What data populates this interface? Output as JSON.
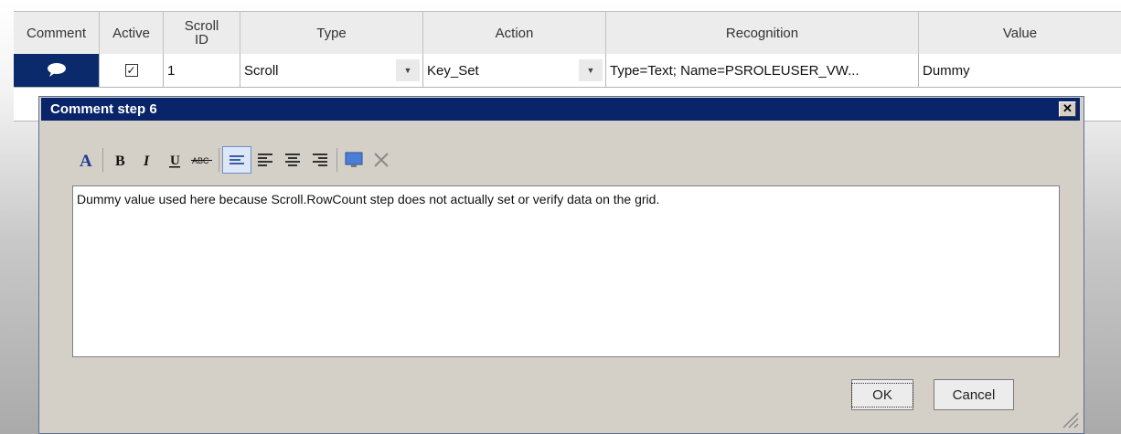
{
  "grid": {
    "columns": [
      "Comment",
      "Active",
      "Scroll ID",
      "Type",
      "Action",
      "Recognition",
      "Value"
    ],
    "row": {
      "active_mark": "✓",
      "scroll_id": "1",
      "type": "Scroll",
      "action": "Key_Set",
      "recognition": "Type=Text; Name=PSROLEUSER_VW...",
      "value": "Dummy"
    }
  },
  "dialog": {
    "title": "Comment step 6",
    "close_label": "✕",
    "toolbar": [
      "font-color-icon",
      "bold-icon",
      "italic-icon",
      "underline-icon",
      "strikethrough-icon",
      "wrap-icon",
      "align-left-icon",
      "align-center-icon",
      "align-right-icon",
      "insert-image-icon",
      "delete-icon"
    ],
    "comment_text": "Dummy value used here because Scroll.RowCount step does not actually set or verify data on the grid.",
    "ok_label": "OK",
    "cancel_label": "Cancel"
  }
}
